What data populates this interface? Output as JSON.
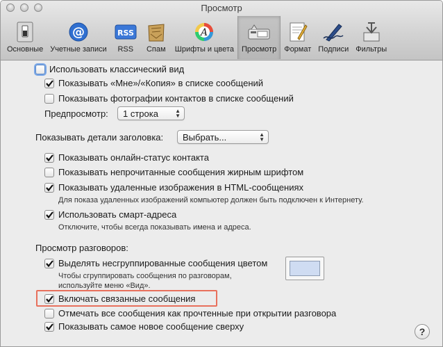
{
  "window": {
    "title": "Просмотр"
  },
  "toolbar": {
    "items": [
      {
        "label": "Основные",
        "icon": "switch-icon"
      },
      {
        "label": "Учетные записи",
        "icon": "at-sign-icon"
      },
      {
        "label": "RSS",
        "icon": "rss-icon"
      },
      {
        "label": "Спам",
        "icon": "junk-mail-icon"
      },
      {
        "label": "Шрифты и цвета",
        "icon": "fonts-colors-icon"
      },
      {
        "label": "Просмотр",
        "icon": "viewing-icon",
        "active": true
      },
      {
        "label": "Формат",
        "icon": "compose-icon"
      },
      {
        "label": "Подписи",
        "icon": "signature-icon"
      },
      {
        "label": "Фильтры",
        "icon": "filters-icon"
      }
    ]
  },
  "options": {
    "classic_view": {
      "label": "Использовать классический вид",
      "checked": false
    },
    "show_to_cc": {
      "label": "Показывать «Мне»/«Копия» в списке сообщений",
      "checked": true
    },
    "show_contact_photos": {
      "label": "Показывать фотографии контактов в списке сообщений",
      "checked": false
    },
    "preview_label": "Предпросмотр:",
    "preview_value": "1 строка",
    "header_detail_label": "Показывать детали заголовка:",
    "header_detail_value": "Выбрать...",
    "online_status": {
      "label": "Показывать онлайн-статус контакта",
      "checked": true
    },
    "unread_bold": {
      "label": "Показывать непрочитанные сообщения жирным шрифтом",
      "checked": false
    },
    "remote_images": {
      "label": "Показывать удаленные изображения в HTML-сообщениях",
      "checked": true
    },
    "remote_images_note": "Для показа удаленных изображений компьютер должен быть подключен к Интернету.",
    "smart_addresses": {
      "label": "Использовать смарт-адреса",
      "checked": true
    },
    "smart_addresses_note": "Отключите, чтобы всегда показывать имена и адреса.",
    "conversations_label": "Просмотр разговоров:",
    "highlight_color": {
      "label": "Выделять несгруппированные сообщения цветом",
      "checked": true,
      "color": "#cfdcf2"
    },
    "highlight_note_1": "Чтобы сгруппировать сообщения по разговорам,",
    "highlight_note_2": "используйте меню «Вид».",
    "related_messages": {
      "label": "Включать связанные сообщения",
      "checked": true
    },
    "mark_read": {
      "label": "Отмечать все сообщения как прочтенные при открытии разговора",
      "checked": false
    },
    "newest_top": {
      "label": "Показывать самое новое сообщение сверху",
      "checked": true
    }
  },
  "help_label": "?"
}
